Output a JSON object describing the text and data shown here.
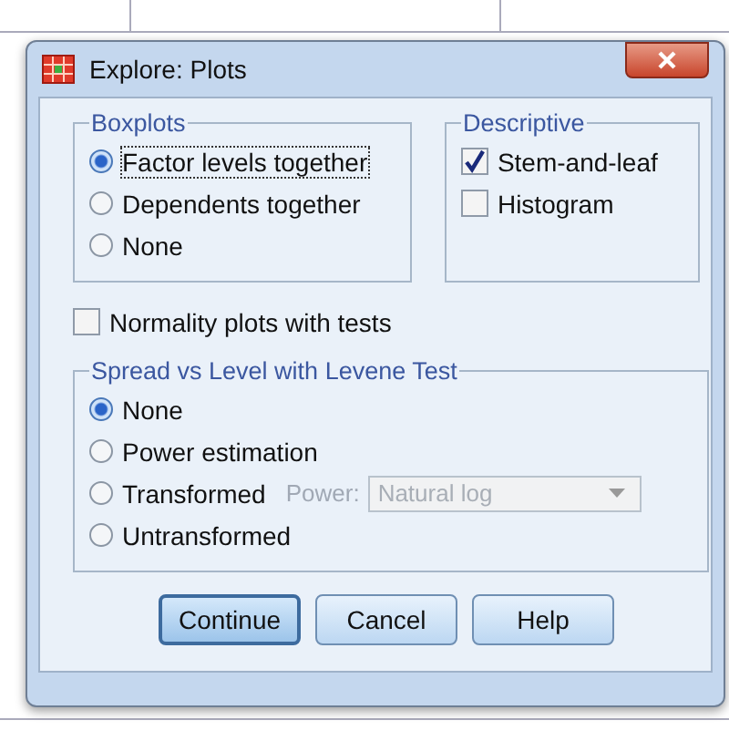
{
  "window": {
    "title": "Explore: Plots"
  },
  "boxplots": {
    "title": "Boxplots",
    "options": [
      {
        "label": "Factor levels together",
        "selected": true,
        "focused": true
      },
      {
        "label": "Dependents together",
        "selected": false,
        "focused": false
      },
      {
        "label": "None",
        "selected": false,
        "focused": false
      }
    ]
  },
  "descriptive": {
    "title": "Descriptive",
    "options": [
      {
        "label": "Stem-and-leaf",
        "checked": true
      },
      {
        "label": "Histogram",
        "checked": false
      }
    ]
  },
  "normality": {
    "label": "Normality plots with tests",
    "checked": false
  },
  "spread": {
    "title": "Spread vs Level with Levene Test",
    "options": [
      {
        "label": "None",
        "selected": true,
        "kind": "plain"
      },
      {
        "label": "Power estimation",
        "selected": false,
        "kind": "plain"
      },
      {
        "label": "Transformed",
        "selected": false,
        "kind": "with_power"
      },
      {
        "label": "Untransformed",
        "selected": false,
        "kind": "plain"
      }
    ],
    "power": {
      "label": "Power:",
      "value": "Natural log",
      "disabled": true
    }
  },
  "buttons": [
    {
      "label": "Continue",
      "default": true
    },
    {
      "label": "Cancel",
      "default": false
    },
    {
      "label": "Help",
      "default": false
    }
  ]
}
